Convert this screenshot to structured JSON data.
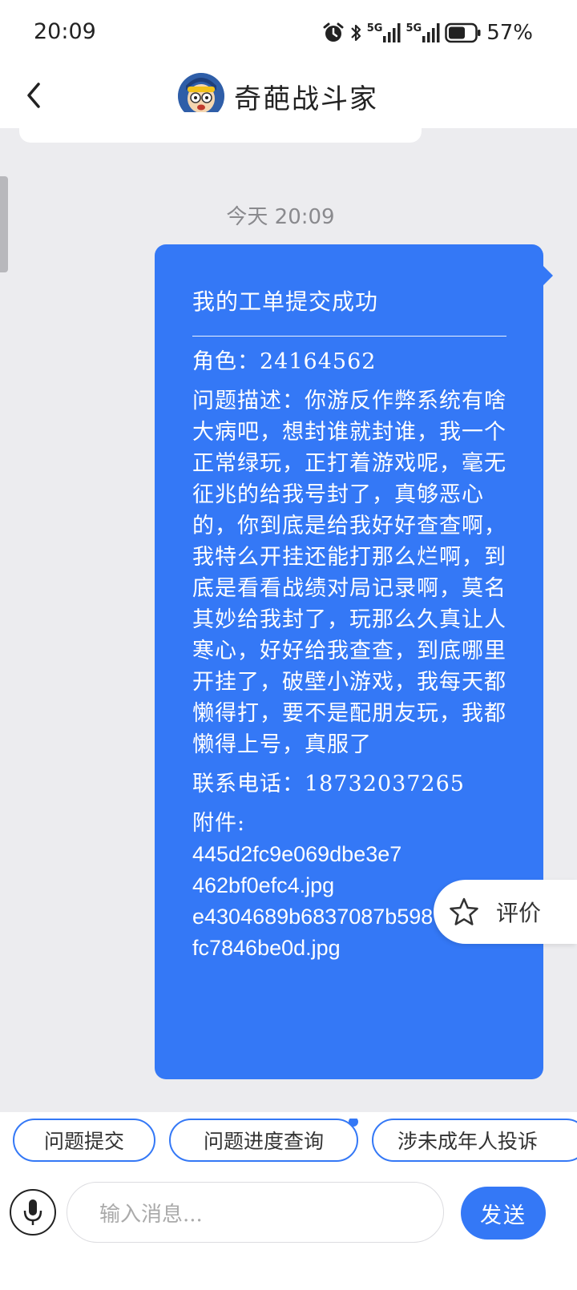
{
  "status_bar": {
    "time": "20:09",
    "battery_percent": "57%",
    "network_1": "5G",
    "network_2": "5G",
    "icons": [
      "alarm-icon",
      "bluetooth-icon",
      "signal-icon",
      "signal-icon",
      "battery-icon"
    ]
  },
  "header": {
    "title": "奇葩战斗家",
    "back_icon": "chevron-left-icon",
    "avatar": "game-mascot-avatar"
  },
  "chat": {
    "date_stamp": "今天 20:09",
    "message": {
      "title": "我的工单提交成功",
      "role": "角色：24164562",
      "description": "问题描述：你游反作弊系统有啥大病吧，想封谁就封谁，我一个正常绿玩，正打着游戏呢，毫无征兆的给我号封了，真够恶心的，你到底是给我好好查查啊，我特么开挂还能打那么烂啊，到底是看看战绩对局记录啊，莫名其妙给我封了，玩那么久真让人寒心，好好给我查查，到底哪里开挂了，破壁小游戏，我每天都懒得打，要不是配朋友玩，我都懒得上号，真服了",
      "phone": "联系电话：18732037265",
      "attachment_label": "附件:",
      "attachments": [
        "445d2fc9e069dbe3e7",
        "462bf0efc4.jpg",
        "e4304689b6837087b59872",
        "fc7846be0d.jpg"
      ]
    }
  },
  "rate_button": {
    "label": "评价",
    "icon": "star-icon"
  },
  "quick_replies": [
    {
      "label": "问题提交"
    },
    {
      "label": "问题进度查询"
    },
    {
      "label": "涉未成年人投诉"
    }
  ],
  "input_bar": {
    "placeholder": "输入消息...",
    "send_label": "发送",
    "mic_icon": "microphone-icon"
  },
  "colors": {
    "accent": "#3478f6",
    "background": "#ececef"
  }
}
